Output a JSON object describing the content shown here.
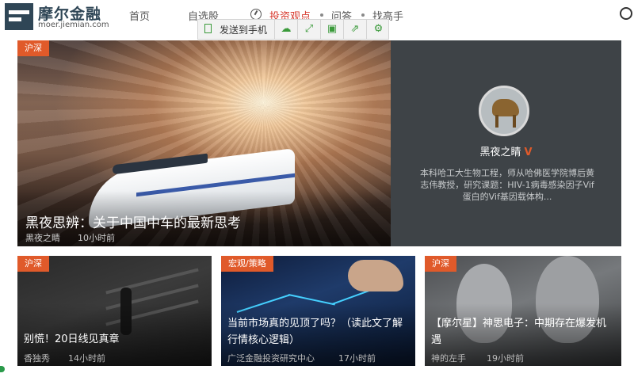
{
  "brand": {
    "name": "摩尔金融",
    "url": "moer.jiemian.com"
  },
  "nav": {
    "items": [
      "首页",
      "自选股",
      "投资观点",
      "问答",
      "找高手"
    ],
    "active": "投资观点"
  },
  "toolbar": {
    "send_label": "发送到手机",
    "icons": [
      "cloud-icon",
      "fullscreen-icon",
      "save-icon",
      "share-icon",
      "settings-icon"
    ]
  },
  "hero": {
    "tag": "沪深",
    "title": "黑夜思辨：关于中国中车的最新思考",
    "author": "黑夜之睛",
    "time": "10小时前"
  },
  "author_panel": {
    "name": "黑夜之睛",
    "verified_mark": "V",
    "bio": "本科哈工大生物工程，师从哈佛医学院博后黄志伟教授，研究课题：HIV-1病毒感染因子Vif蛋白的Vif基因载体构..."
  },
  "cards": [
    {
      "tag": "沪深",
      "title": "别慌！20日线见真章",
      "author": "香独秀",
      "time": "14小时前"
    },
    {
      "tag": "宏观/策略",
      "title": "当前市场真的见顶了吗？（读此文了解行情核心逻辑）",
      "author": "广泛金融投资研究中心",
      "time": "17小时前"
    },
    {
      "tag": "沪深",
      "title": "【摩尔星】神思电子：中期存在爆发机遇",
      "author": "神的左手",
      "time": "19小时前"
    }
  ],
  "colors": {
    "accent": "#e05a2a",
    "active_nav": "#d6382c",
    "panel_bg": "#3e4347",
    "toolbar_icon": "#3a9a3a"
  }
}
